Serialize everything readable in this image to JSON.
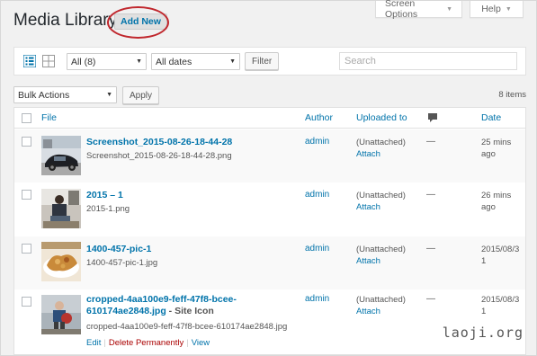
{
  "header": {
    "screen_options": "Screen Options",
    "help": "Help",
    "title": "Media Library",
    "add_new": "Add New"
  },
  "filters": {
    "type_select": "All (8)",
    "date_select": "All dates",
    "filter_button": "Filter",
    "search_placeholder": "Search"
  },
  "bulk": {
    "select": "Bulk Actions",
    "apply": "Apply",
    "count": "8 items"
  },
  "columns": {
    "file": "File",
    "author": "Author",
    "uploaded_to": "Uploaded to",
    "date": "Date"
  },
  "rows": [
    {
      "title": "Screenshot_2015-08-26-18-44-28",
      "filename": "Screenshot_2015-08-26-18-44-28.png",
      "author": "admin",
      "uploaded": "(Unattached)",
      "attach": "Attach",
      "comments": "—",
      "date_line1": "25 mins",
      "date_line2": "ago"
    },
    {
      "title": "2015 – 1",
      "filename": "2015-1.png",
      "author": "admin",
      "uploaded": "(Unattached)",
      "attach": "Attach",
      "comments": "—",
      "date_line1": "26 mins",
      "date_line2": "ago"
    },
    {
      "title": "1400-457-pic-1",
      "filename": "1400-457-pic-1.jpg",
      "author": "admin",
      "uploaded": "(Unattached)",
      "attach": "Attach",
      "comments": "—",
      "date_line1": "2015/08/3",
      "date_line2": "1"
    },
    {
      "title_line1": "cropped-4aa100e9-feff-47f8-bcee-",
      "title_line2": "610174ae2848.jpg",
      "title_suffix": " - Site Icon",
      "filename": "cropped-4aa100e9-feff-47f8-bcee-610174ae2848.jpg",
      "author": "admin",
      "uploaded": "(Unattached)",
      "attach": "Attach",
      "comments": "—",
      "date_line1": "2015/08/3",
      "date_line2": "1",
      "actions": {
        "edit": "Edit",
        "delete": "Delete Permanently",
        "view": "View"
      }
    }
  ],
  "watermark": "laoji.org",
  "accent": "#0073aa",
  "annotation_color": "#c0272d"
}
